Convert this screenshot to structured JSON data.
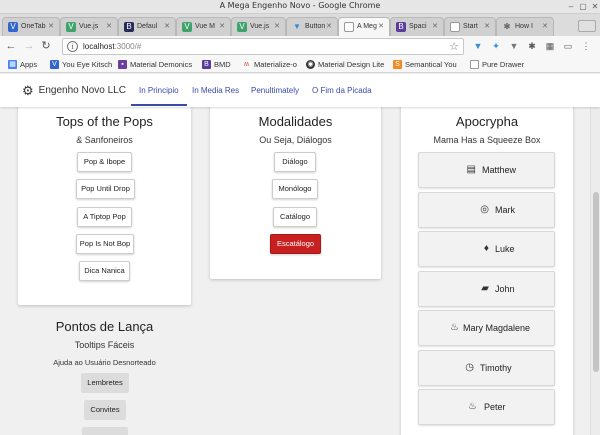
{
  "window": {
    "title": "A Mega Engenho Novo - Google Chrome"
  },
  "tabs": [
    {
      "label": "OneTab",
      "fav": "V",
      "favColor": "#3366cc"
    },
    {
      "label": "Vue.js",
      "fav": "V",
      "favColor": "#3fa36b"
    },
    {
      "label": "Defaul",
      "fav": "B",
      "favColor": "#2a2a5a"
    },
    {
      "label": "Vue M",
      "fav": "V",
      "favColor": "#3fa36b"
    },
    {
      "label": "Vue.js",
      "fav": "V",
      "favColor": "#3fa36b"
    },
    {
      "label": "Button",
      "fav": "▼",
      "favColor": "#2d8fe0"
    },
    {
      "label": "A Meg",
      "fav": "",
      "favColor": "#888"
    },
    {
      "label": "Spaci",
      "fav": "B",
      "favColor": "#5b3c9c"
    },
    {
      "label": "Start",
      "fav": "",
      "favColor": "#888"
    },
    {
      "label": "How I",
      "fav": "✻",
      "favColor": "#333"
    }
  ],
  "toolbar": {
    "url_host": "localhost",
    "url_rest": ":3000/#"
  },
  "bookmarks": [
    {
      "label": "Apps",
      "icon": "apps-icon",
      "color": "#4285f4"
    },
    {
      "label": "You Eye Kitsch",
      "icon": "v-icon",
      "color": "#3366cc"
    },
    {
      "label": "Material Demonics",
      "icon": "material-icon",
      "color": "#6a3fa0"
    },
    {
      "label": "BMD",
      "icon": "b-icon",
      "color": "#5b3c9c"
    },
    {
      "label": "Materialize-o",
      "icon": "m-icon",
      "color": "#e54848"
    },
    {
      "label": "Material Design Lite",
      "icon": "mdl-icon",
      "color": "#333"
    },
    {
      "label": "Semantical You",
      "icon": "su-icon",
      "color": "#f08a24"
    },
    {
      "label": "Pure Drawer",
      "icon": "page-icon",
      "color": "#777"
    }
  ],
  "appnav": {
    "brand": "Engenho Novo LLC",
    "links": [
      "In Principio",
      "In Media Res",
      "Penultimately",
      "O Fim da Picada"
    ],
    "active": 0
  },
  "tops": {
    "title": "Tops of the Pops",
    "subtitle": "& Sanfoneiros",
    "buttons": [
      "Pop & Ibope",
      "Pop Until Drop",
      "A Tiptop Pop",
      "Pop Is Not Bop",
      "Dica Nanica"
    ]
  },
  "modalidades": {
    "title": "Modalidades",
    "subtitle": "Ou Seja, Diálogos",
    "buttons": [
      "Diálogo",
      "Monólogo",
      "Catálogo",
      "Escatálogo"
    ]
  },
  "apocrypha": {
    "title": "Apocrypha",
    "subtitle": "Mama Has a Squeeze Box",
    "items": [
      {
        "label": "Matthew",
        "icon": "list-icon",
        "glyph": "▤"
      },
      {
        "label": "Mark",
        "icon": "target-icon",
        "glyph": "◎"
      },
      {
        "label": "Luke",
        "icon": "flame-icon",
        "glyph": "♦"
      },
      {
        "label": "John",
        "icon": "book-icon",
        "glyph": "▰"
      },
      {
        "label": "Mary Magdalene",
        "icon": "fire-icon",
        "glyph": "♨"
      },
      {
        "label": "Timothy",
        "icon": "clock-icon",
        "glyph": "◷"
      },
      {
        "label": "Peter",
        "icon": "fire-icon",
        "glyph": "♨"
      }
    ]
  },
  "pontos": {
    "title": "Pontos de Lança",
    "subtitle": "Tooltips Fáceis",
    "caption": "Ajuda ao Usuário Desnorteado",
    "buttons": [
      "Lembretes",
      "Convites"
    ]
  }
}
